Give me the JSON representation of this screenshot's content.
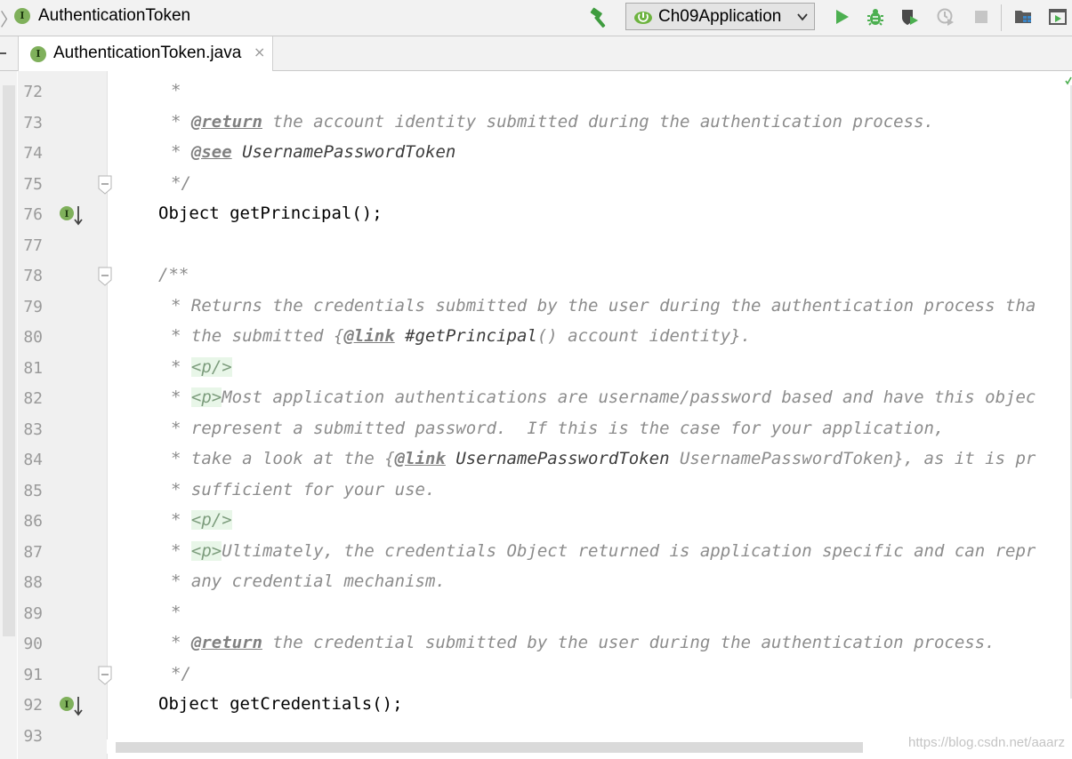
{
  "navbar": {
    "title": "AuthenticationToken",
    "badge_letter": "I"
  },
  "toolbar": {
    "run_configuration": "Ch09Application",
    "icons": [
      "build-hammer-icon",
      "run-icon",
      "debug-icon",
      "coverage-icon",
      "profile-icon",
      "stop-icon",
      "project-structure-icon",
      "run-dashboard-icon"
    ]
  },
  "tab": {
    "label": "AuthenticationToken.java",
    "badge_letter": "I",
    "close_glyph": "×"
  },
  "editor": {
    "lines": [
      {
        "number": "72",
        "segments": [
          {
            "t": "* ",
            "s": "c"
          }
        ]
      },
      {
        "number": "73",
        "segments": [
          {
            "t": "* ",
            "s": "c"
          },
          {
            "t": "@return",
            "s": "tag-kw"
          },
          {
            "t": " the account identity submitted during the authentication process.",
            "s": "c"
          }
        ]
      },
      {
        "number": "74",
        "segments": [
          {
            "t": "* ",
            "s": "c"
          },
          {
            "t": "@see",
            "s": "tag-kw"
          },
          {
            "t": " ",
            "s": "c"
          },
          {
            "t": "UsernamePasswordToken",
            "s": "ref"
          }
        ]
      },
      {
        "number": "75",
        "segments": [
          {
            "t": "*/",
            "s": "c"
          }
        ]
      },
      {
        "number": "76",
        "segments": [
          {
            "t": "Object getPrincipal();",
            "s": "plain"
          }
        ]
      },
      {
        "number": "77",
        "segments": []
      },
      {
        "number": "78",
        "segments": [
          {
            "t": "/**",
            "s": "c"
          }
        ]
      },
      {
        "number": "79",
        "segments": [
          {
            "t": "* Returns the credentials submitted by the user during the authentication process tha",
            "s": "c"
          }
        ]
      },
      {
        "number": "80",
        "segments": [
          {
            "t": "* the submitted {",
            "s": "c"
          },
          {
            "t": "@link",
            "s": "tag-kw"
          },
          {
            "t": " #getPrincipal",
            "s": "ref"
          },
          {
            "t": "() account identity}.",
            "s": "c"
          }
        ]
      },
      {
        "number": "81",
        "segments": [
          {
            "t": "* ",
            "s": "c"
          },
          {
            "t": "<p/>",
            "s": "html-tag"
          }
        ]
      },
      {
        "number": "82",
        "segments": [
          {
            "t": "* ",
            "s": "c"
          },
          {
            "t": "<p>",
            "s": "html-tag"
          },
          {
            "t": "Most application authentications are username/password based and have this objec",
            "s": "c"
          }
        ]
      },
      {
        "number": "83",
        "segments": [
          {
            "t": "* represent a submitted password.  If this is the case for your application,",
            "s": "c"
          }
        ]
      },
      {
        "number": "84",
        "segments": [
          {
            "t": "* take a look at the {",
            "s": "c"
          },
          {
            "t": "@link",
            "s": "tag-kw"
          },
          {
            "t": " UsernamePasswordToken",
            "s": "ref"
          },
          {
            "t": " UsernamePasswordToken}, as it is pr",
            "s": "c"
          }
        ]
      },
      {
        "number": "85",
        "segments": [
          {
            "t": "* sufficient for your use.",
            "s": "c"
          }
        ]
      },
      {
        "number": "86",
        "segments": [
          {
            "t": "* ",
            "s": "c"
          },
          {
            "t": "<p/>",
            "s": "html-tag"
          }
        ]
      },
      {
        "number": "87",
        "segments": [
          {
            "t": "* ",
            "s": "c"
          },
          {
            "t": "<p>",
            "s": "html-tag"
          },
          {
            "t": "Ultimately, the credentials Object returned is application specific and can repr",
            "s": "c"
          }
        ]
      },
      {
        "number": "88",
        "segments": [
          {
            "t": "* any credential mechanism.",
            "s": "c"
          }
        ]
      },
      {
        "number": "89",
        "segments": [
          {
            "t": "*",
            "s": "c"
          }
        ]
      },
      {
        "number": "90",
        "segments": [
          {
            "t": "* ",
            "s": "c"
          },
          {
            "t": "@return",
            "s": "tag-kw"
          },
          {
            "t": " the credential submitted by the user during the authentication process.",
            "s": "c"
          }
        ]
      },
      {
        "number": "91",
        "segments": [
          {
            "t": "*/",
            "s": "c"
          }
        ]
      },
      {
        "number": "92",
        "segments": [
          {
            "t": "Object getCredentials();",
            "s": "plain"
          }
        ]
      },
      {
        "number": "93",
        "segments": []
      }
    ],
    "fold_lines": [
      "75",
      "78",
      "91"
    ],
    "implemented_lines": [
      "76",
      "92"
    ]
  },
  "watermark": "https://blog.csdn.net/aaarz",
  "colors": {
    "comment": "#8c8c8c",
    "gutter": "#f0f0f0",
    "interface_badge": "#7fb05b",
    "run_green": "#4caf50"
  }
}
